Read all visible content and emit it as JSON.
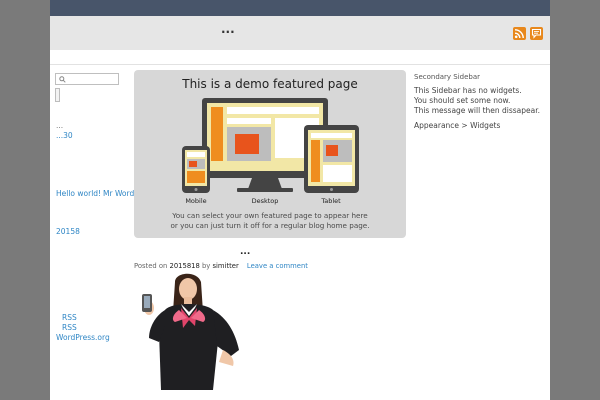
{
  "header": {
    "site_title": "...",
    "icons": [
      "rss-icon",
      "comment-icon"
    ],
    "accent_color": "#e8881c",
    "topbar_color": "#48556a"
  },
  "search": {
    "placeholder": ""
  },
  "left_sidebar": {
    "archive_dots": "...",
    "archive_item": "...30",
    "recent_post": "Hello world!",
    "recent_author": "Mr WordPress",
    "archive_year": "20158",
    "meta_links": [
      "RSS",
      "RSS",
      "WordPress.org"
    ]
  },
  "featured": {
    "title": "This is a demo featured page",
    "device_labels": [
      "Mobile",
      "Desktop",
      "Tablet"
    ],
    "caption_line1": "You can select your own featured page to appear here",
    "caption_line2": "or you can just turn it off for a regular blog home page."
  },
  "post": {
    "title": "...",
    "posted_on": "Posted on",
    "date": "2015818",
    "by": "by",
    "author": "simitter",
    "leave_comment": "Leave a comment"
  },
  "right_sidebar": {
    "title": "Secondary Sidebar",
    "line1": "This Sidebar has no widgets.",
    "line2": "You should set some now.",
    "line3": "This message will then dissapear.",
    "link": "Appearance > Widgets"
  }
}
